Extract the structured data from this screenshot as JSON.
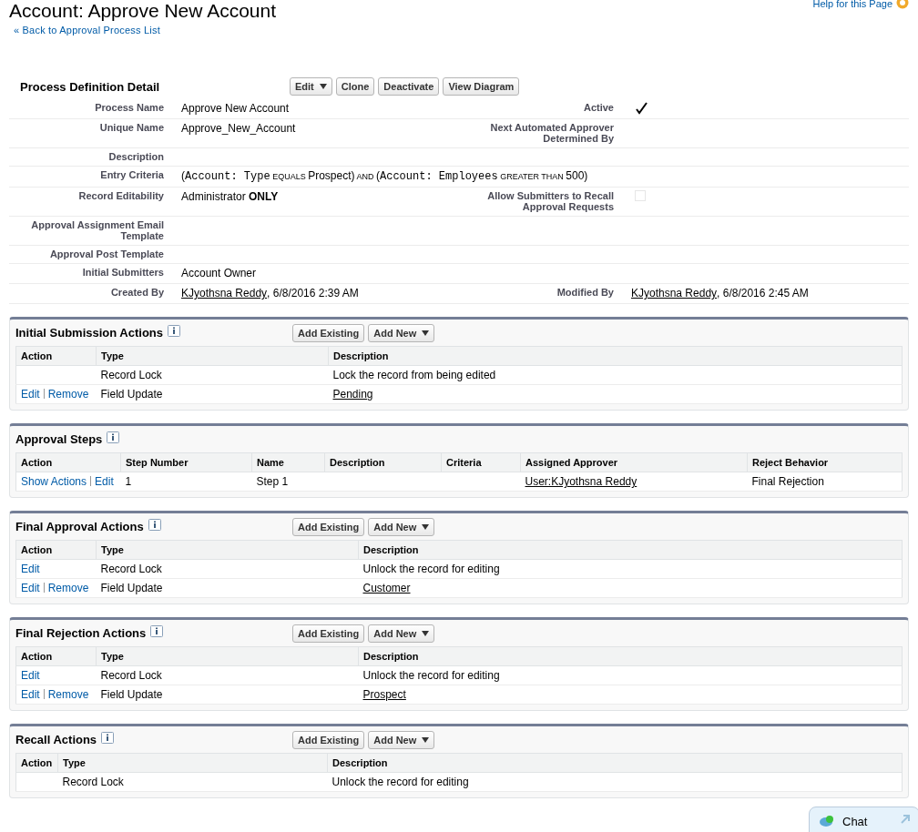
{
  "page": {
    "title": "Account: Approve New Account",
    "back_link": "« Back to Approval Process List",
    "help_link": "Help for this Page"
  },
  "detail": {
    "title": "Process Definition Detail",
    "buttons": [
      {
        "label": "Edit",
        "dropdown": true
      },
      {
        "label": "Clone",
        "dropdown": false
      },
      {
        "label": "Deactivate",
        "dropdown": false
      },
      {
        "label": "View Diagram",
        "dropdown": false
      }
    ],
    "rows": [
      {
        "label": "Process Name",
        "value": [
          {
            "kind": "text",
            "text": "Approve New Account"
          }
        ],
        "right_label": "Active",
        "right_value": {
          "kind": "checkbox",
          "checked": true
        }
      },
      {
        "label": "Unique Name",
        "value": [
          {
            "kind": "text",
            "text": "Approve_New_Account"
          }
        ],
        "right_label": "Next Automated Approver Determined By"
      },
      {
        "label": "Description",
        "value": []
      },
      {
        "label": "Entry Criteria",
        "value": [
          {
            "kind": "text",
            "text": "("
          },
          {
            "kind": "mono",
            "text": "Account: Type"
          },
          {
            "kind": "op",
            "text": " EQUALS "
          },
          {
            "kind": "text",
            "text": "Prospect)"
          },
          {
            "kind": "op",
            "text": " AND "
          },
          {
            "kind": "text",
            "text": "("
          },
          {
            "kind": "mono",
            "text": "Account: Employees"
          },
          {
            "kind": "op",
            "text": " GREATER THAN "
          },
          {
            "kind": "text",
            "text": "500)"
          }
        ]
      },
      {
        "label": "Record Editability",
        "value": [
          {
            "kind": "rich",
            "text": "Administrator **ONLY**"
          }
        ],
        "right_label": "Allow Submitters to Recall Approval Requests",
        "right_value": {
          "kind": "checkbox",
          "checked": false
        }
      },
      {
        "label": "Approval Assignment Email Template",
        "value": []
      },
      {
        "label": "Approval Post Template",
        "value": []
      },
      {
        "label": "Initial Submitters",
        "value": [
          {
            "kind": "text",
            "text": "Account Owner"
          }
        ]
      },
      {
        "label": "Created By",
        "value": [
          {
            "kind": "link",
            "text": "KJyothsna Reddy"
          },
          {
            "kind": "text",
            "text": ", 6/8/2016 2:39 AM"
          }
        ],
        "right_label": "Modified By",
        "right_value": {
          "kind": "parts",
          "parts": [
            {
              "kind": "link",
              "text": "KJyothsna Reddy"
            },
            {
              "kind": "text",
              "text": ", 6/8/2016 2:45 AM"
            }
          ]
        }
      }
    ]
  },
  "sections": [
    {
      "title": "Initial Submission Actions",
      "buttons": [
        {
          "label": "Add Existing",
          "dropdown": false
        },
        {
          "label": "Add New",
          "dropdown": true
        }
      ],
      "columns": [
        "Action",
        "Type",
        "Description"
      ],
      "rows": [
        [
          {
            "kind": "actions"
          },
          {
            "kind": "text",
            "text": "Record Lock"
          },
          {
            "kind": "text",
            "text": "Lock the record from being edited"
          }
        ],
        [
          {
            "kind": "actions",
            "links": [
              "Edit",
              "Remove"
            ]
          },
          {
            "kind": "text",
            "text": "Field Update"
          },
          {
            "kind": "link",
            "text": "Pending"
          }
        ]
      ]
    },
    {
      "title": "Approval Steps",
      "columns": [
        "Action",
        "Step Number",
        "Name",
        "Description",
        "Criteria",
        "Assigned Approver",
        "Reject Behavior"
      ],
      "rows": [
        [
          {
            "kind": "actions",
            "links": [
              "Show Actions",
              "Edit"
            ]
          },
          {
            "kind": "text",
            "text": "1"
          },
          {
            "kind": "text",
            "text": "Step 1"
          },
          {
            "kind": "text",
            "text": ""
          },
          {
            "kind": "text",
            "text": ""
          },
          {
            "kind": "link",
            "text": "User:KJyothsna Reddy"
          },
          {
            "kind": "text",
            "text": "Final Rejection"
          }
        ]
      ]
    },
    {
      "title": "Final Approval Actions",
      "buttons": [
        {
          "label": "Add Existing",
          "dropdown": false
        },
        {
          "label": "Add New",
          "dropdown": true
        }
      ],
      "columns": [
        "Action",
        "Type",
        "Description"
      ],
      "rows": [
        [
          {
            "kind": "actions",
            "links": [
              "Edit"
            ]
          },
          {
            "kind": "text",
            "text": "Record Lock"
          },
          {
            "kind": "text",
            "text": "Unlock the record for editing"
          }
        ],
        [
          {
            "kind": "actions",
            "links": [
              "Edit",
              "Remove"
            ]
          },
          {
            "kind": "text",
            "text": "Field Update"
          },
          {
            "kind": "link",
            "text": "Customer"
          }
        ]
      ]
    },
    {
      "title": "Final Rejection Actions",
      "buttons": [
        {
          "label": "Add Existing",
          "dropdown": false
        },
        {
          "label": "Add New",
          "dropdown": true
        }
      ],
      "columns": [
        "Action",
        "Type",
        "Description"
      ],
      "rows": [
        [
          {
            "kind": "actions",
            "links": [
              "Edit"
            ]
          },
          {
            "kind": "text",
            "text": "Record Lock"
          },
          {
            "kind": "text",
            "text": "Unlock the record for editing"
          }
        ],
        [
          {
            "kind": "actions",
            "links": [
              "Edit",
              "Remove"
            ]
          },
          {
            "kind": "text",
            "text": "Field Update"
          },
          {
            "kind": "link",
            "text": "Prospect"
          }
        ]
      ]
    },
    {
      "title": "Recall Actions",
      "buttons": [
        {
          "label": "Add Existing",
          "dropdown": false
        },
        {
          "label": "Add New",
          "dropdown": true
        }
      ],
      "columns": [
        "Action",
        "Type",
        "Description"
      ],
      "rows": [
        [
          {
            "kind": "actions"
          },
          {
            "kind": "text",
            "text": "Record Lock"
          },
          {
            "kind": "text",
            "text": "Unlock the record for editing"
          }
        ]
      ]
    }
  ],
  "chat": {
    "label": "Chat"
  }
}
